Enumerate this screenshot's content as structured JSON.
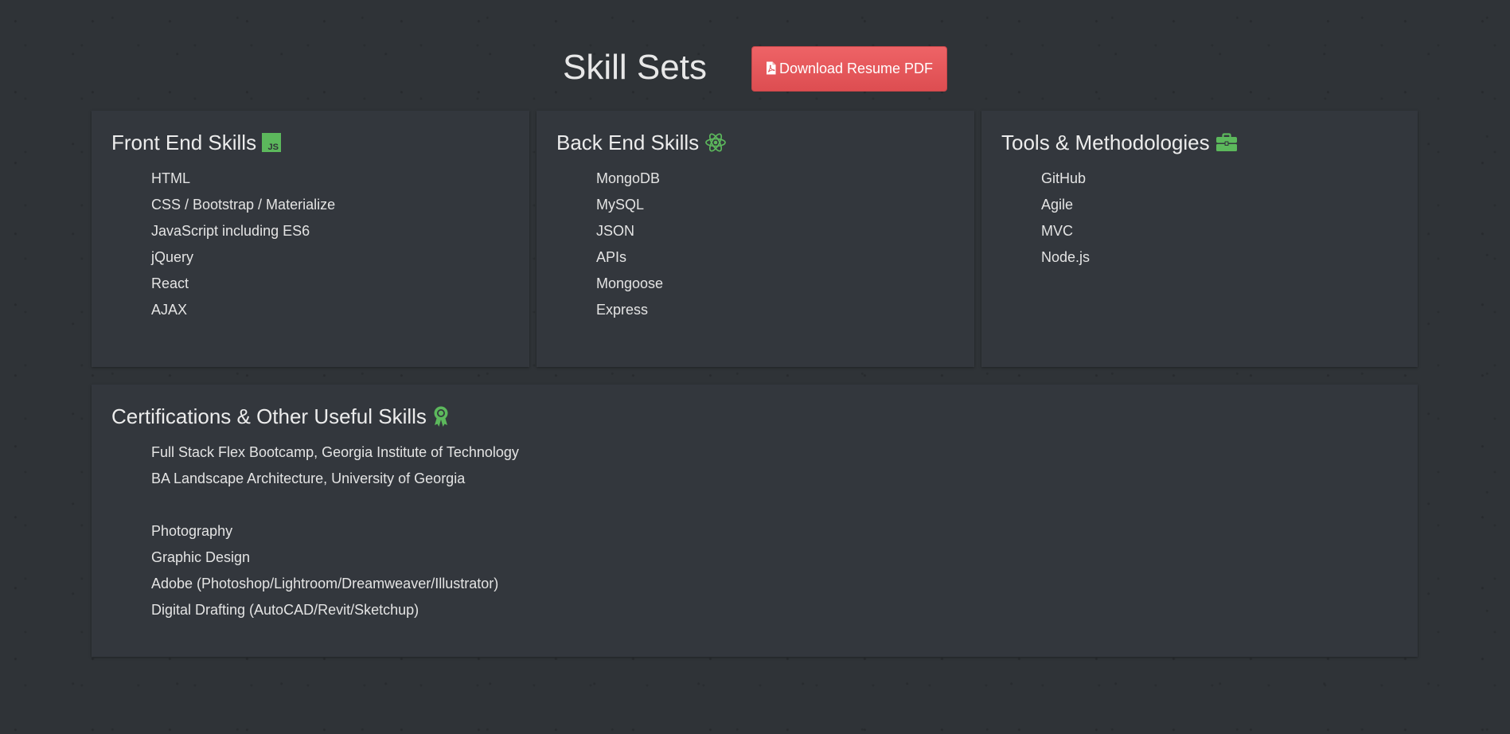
{
  "header": {
    "title": "Skill Sets",
    "resume_button_label": "Download Resume PDF",
    "resume_button_icon": "file-pdf-icon"
  },
  "colors": {
    "background": "#2f3337",
    "card": "#33373d",
    "accent_green": "#5cb85c",
    "button_red": "#e5575a"
  },
  "cards": {
    "front_end": {
      "title": "Front End Skills",
      "icon": "js-icon",
      "items": [
        "HTML",
        "CSS / Bootstrap / Materialize",
        "JavaScript including ES6",
        "jQuery",
        "React",
        "AJAX"
      ]
    },
    "back_end": {
      "title": "Back End Skills",
      "icon": "react-atom-icon",
      "items": [
        "MongoDB",
        "MySQL",
        "JSON",
        "APIs",
        "Mongoose",
        "Express"
      ]
    },
    "tools": {
      "title": "Tools & Methodologies",
      "icon": "toolbox-icon",
      "items": [
        "GitHub",
        "Agile",
        "MVC",
        "Node.js"
      ]
    },
    "certifications": {
      "title": "Certifications & Other Useful Skills",
      "icon": "award-icon",
      "items": [
        "Full Stack Flex Bootcamp, Georgia Institute of Technology",
        "BA Landscape Architecture, University of Georgia",
        "",
        "Photography",
        "Graphic Design",
        "Adobe (Photoshop/Lightroom/Dreamweaver/Illustrator)",
        "Digital Drafting (AutoCAD/Revit/Sketchup)"
      ]
    }
  }
}
